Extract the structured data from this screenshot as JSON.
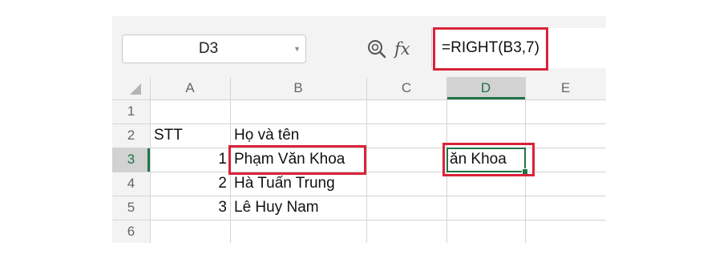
{
  "name_box": {
    "value": "D3",
    "icon": "chevron-down-icon"
  },
  "formula_bar": {
    "zoom_icon": "magnifier-icon",
    "fx_label": "fx",
    "formula": "=RIGHT(B3,7)"
  },
  "columns": [
    "A",
    "B",
    "C",
    "D",
    "E"
  ],
  "rows": [
    "1",
    "2",
    "3",
    "4",
    "5",
    "6"
  ],
  "cells": {
    "A2": "STT",
    "B2": "Họ và tên",
    "A3": "1",
    "B3": "Phạm Văn Khoa",
    "D3": "ăn Khoa",
    "A4": "2",
    "B4": "Hà Tuấn Trung",
    "A5": "3",
    "B5": "Lê Huy Nam"
  },
  "colors": {
    "highlight_red": "#d9233a",
    "active_green": "#217346",
    "header_active_bg": "#d2d2d2"
  }
}
